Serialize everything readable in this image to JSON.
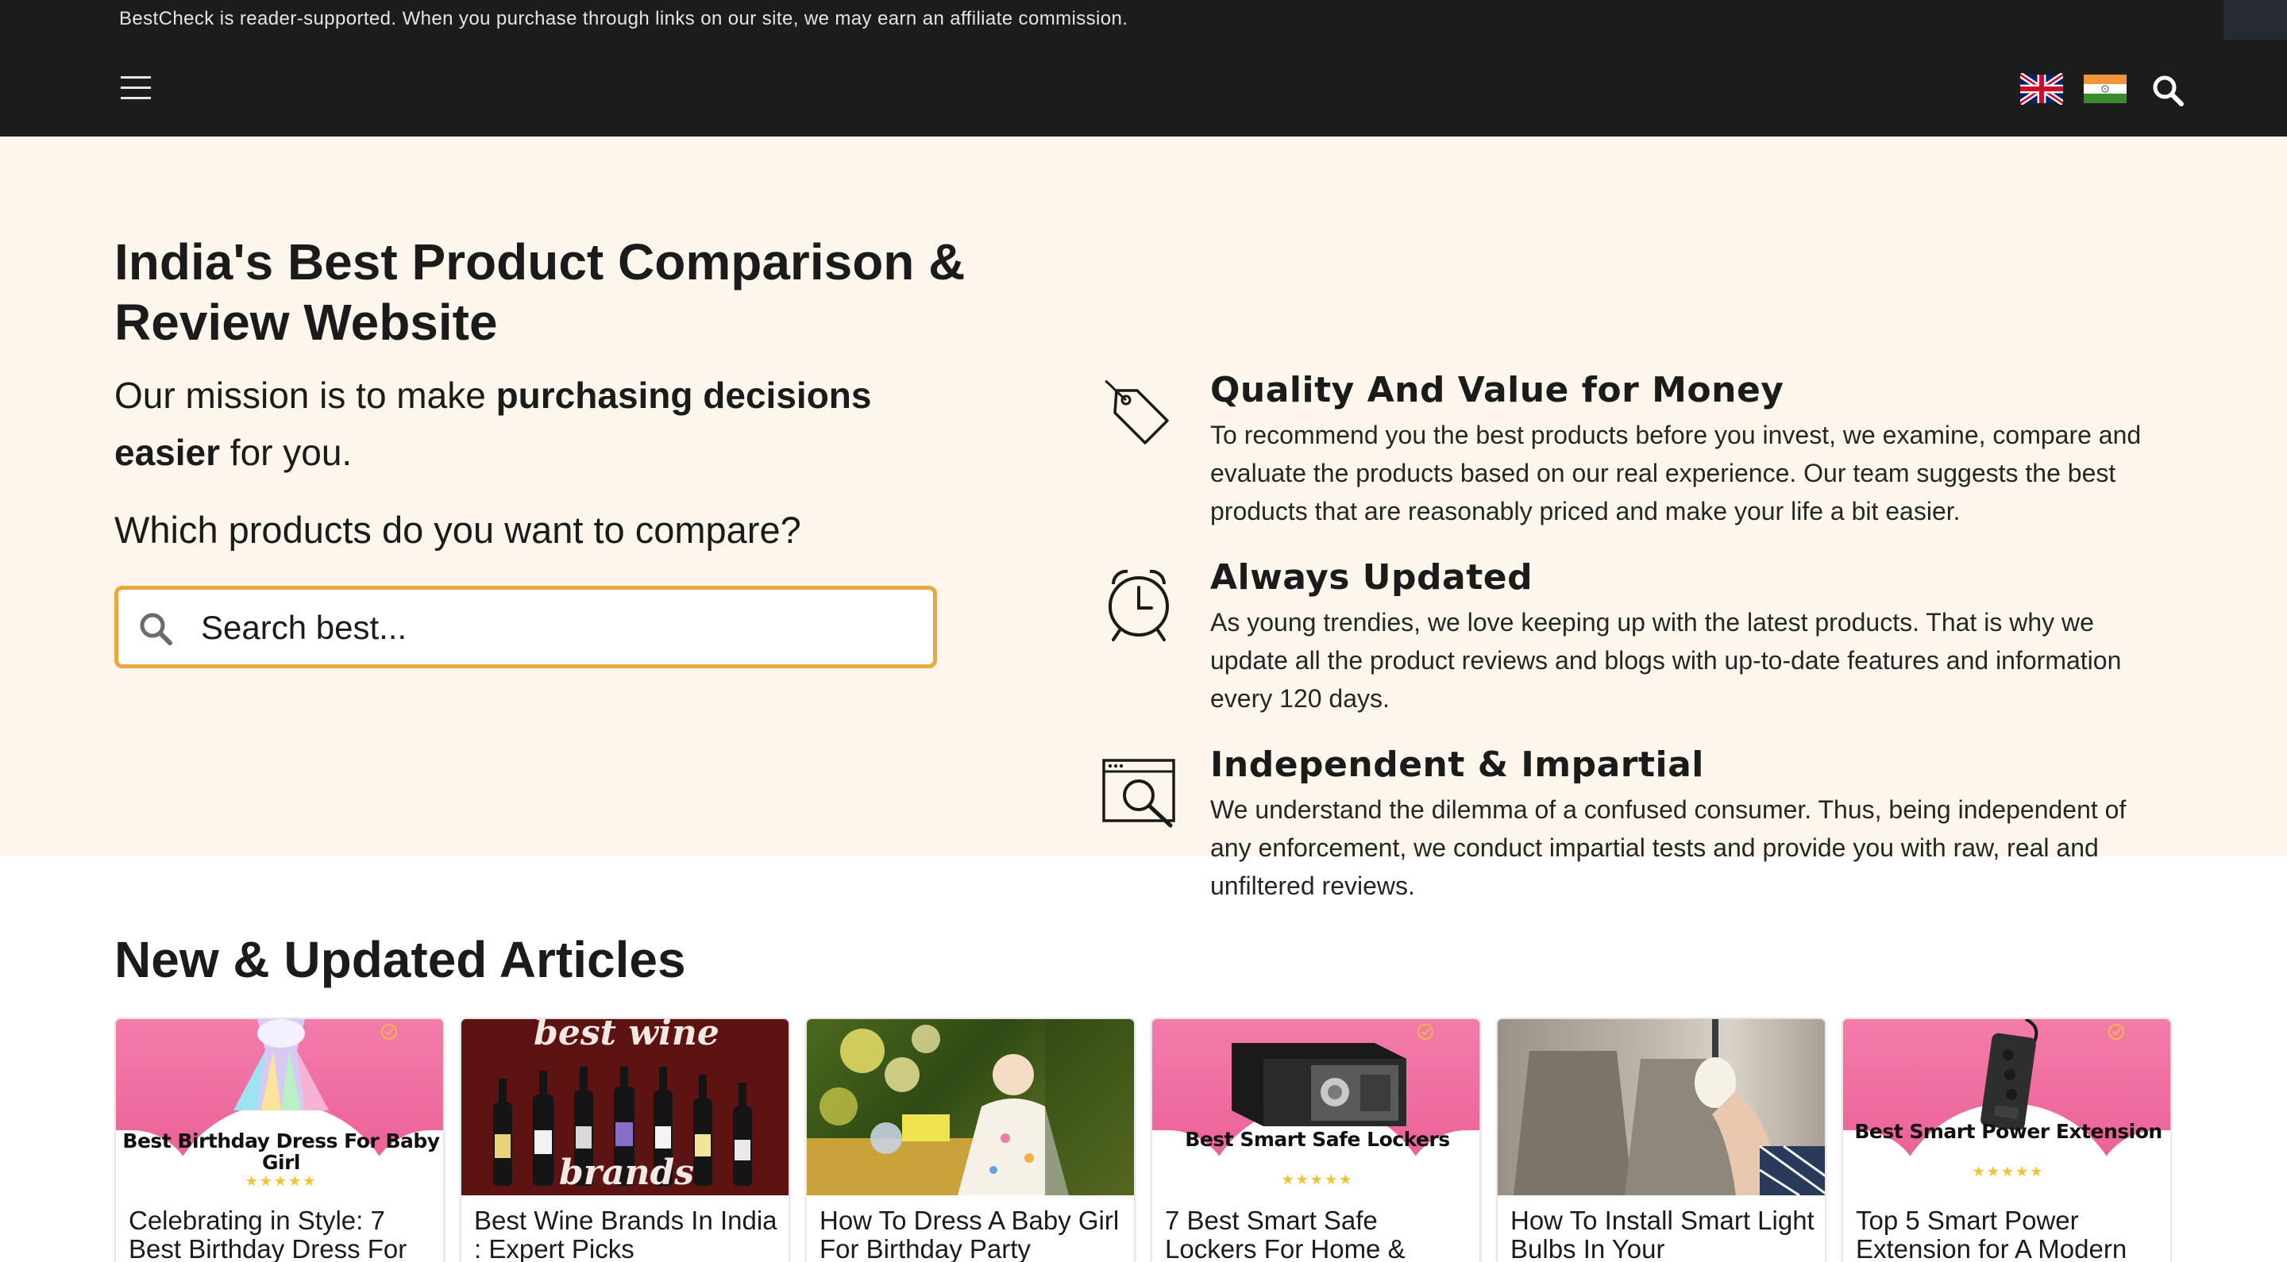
{
  "disclosure": "BestCheck is reader-supported. When you purchase through links on our site, we may earn an affiliate commission.",
  "header": {
    "icons": [
      "menu-icon",
      "uk-flag-icon",
      "india-flag-icon",
      "search-icon"
    ]
  },
  "hero": {
    "title": "India's Best Product Comparison & Review Website",
    "mission_pre": "Our mission is to make ",
    "mission_bold": "purchasing decisions easier",
    "mission_post": " for you.",
    "compare_question": "Which products do you want to compare?",
    "search_placeholder": "Search best..."
  },
  "features": [
    {
      "icon": "price-tag-icon",
      "title": "Quality And Value for Money",
      "text": "To recommend you the best products before you invest, we examine, compare and evaluate the products based on our real experience. Our team suggests the best products that are reasonably priced and make your life a bit easier."
    },
    {
      "icon": "alarm-clock-icon",
      "title": "Always Updated",
      "text": "As young trendies, we love keeping up with the latest products. That is why we update all the product reviews and blogs with up-to-date features and information every 120 days."
    },
    {
      "icon": "browser-search-icon",
      "title": "Independent & Impartial",
      "text": "We understand the dilemma of a confused consumer. Thus, being independent of any enforcement, we conduct impartial tests and provide you with raw, real and unfiltered reviews."
    }
  ],
  "articles": {
    "heading": "New & Updated Articles",
    "items": [
      {
        "title": "Celebrating in Style: 7 Best Birthday Dress For",
        "thumb_label": "Best Birthday Dress For Baby Girl",
        "stars": "★★★★★"
      },
      {
        "title": "Best Wine Brands In India : Expert Picks",
        "thumb_top": "best wine",
        "thumb_bottom": "brands"
      },
      {
        "title": "How To Dress A Baby Girl For Birthday Party"
      },
      {
        "title": "7 Best Smart Safe Lockers For Home &",
        "thumb_label": "Best Smart Safe Lockers",
        "stars": "★★★★★"
      },
      {
        "title": "How To Install Smart Light Bulbs In Your"
      },
      {
        "title": "Top 5 Smart Power Extension for A Modern",
        "thumb_label": "Best Smart Power Extension",
        "stars": "★★★★★"
      }
    ]
  },
  "colors": {
    "header_bg": "#1c1c1c",
    "hero_bg": "#fdf6ec",
    "search_border": "#e8a83b",
    "card_pink": "#ee6a9d",
    "star_gold": "#f1c232"
  }
}
